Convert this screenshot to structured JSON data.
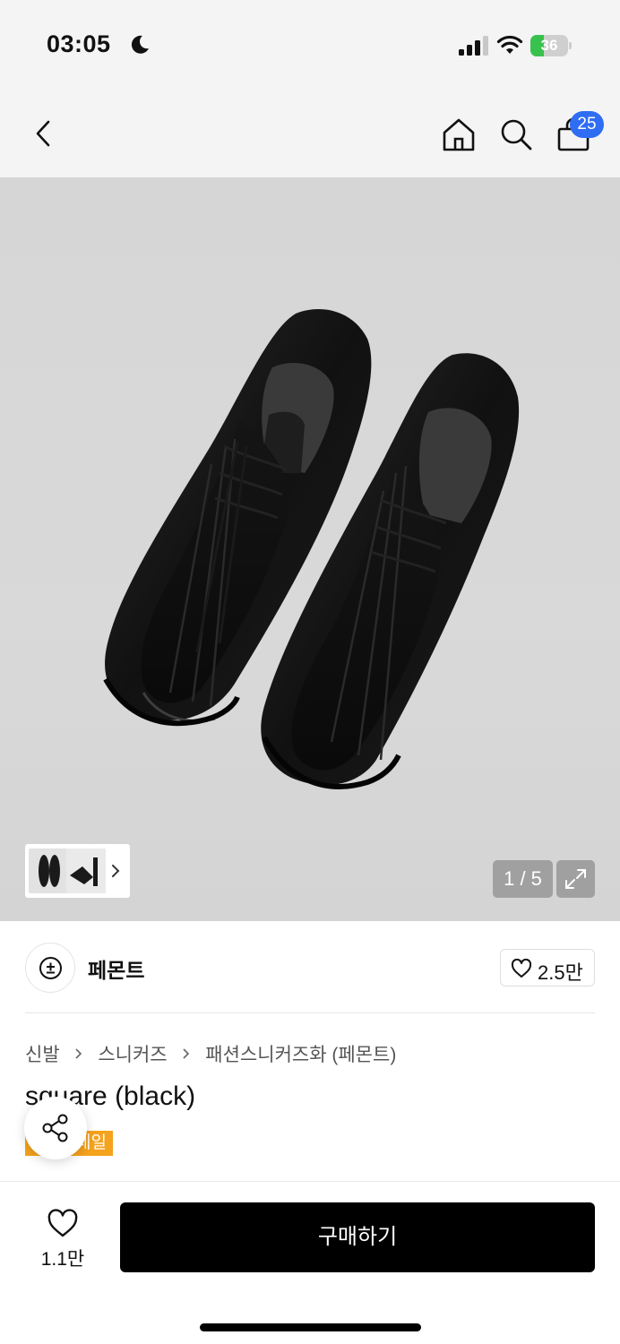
{
  "status_bar": {
    "time": "03:05",
    "battery_percent": "36",
    "battery_level": 0.36
  },
  "nav": {
    "cart_count": "25"
  },
  "gallery": {
    "page_indicator": "1 / 5"
  },
  "brand": {
    "name": "페몬트",
    "like_count": "2.5만"
  },
  "breadcrumb": [
    "신발",
    "스니커즈",
    "패션스니커즈화 (페몬트)"
  ],
  "product": {
    "title": "square (black)",
    "badge": "세일"
  },
  "purchase": {
    "wish_count": "1.1만",
    "buy_label": "구매하기"
  },
  "colors": {
    "accent_blue": "#2f6df3",
    "sale_orange": "#f5a21c",
    "buy_button": "#000000",
    "battery_green": "#39c14d"
  },
  "icons": [
    "moon-icon",
    "signal-icon",
    "wifi-icon",
    "battery-icon",
    "back-arrow-icon",
    "home-icon",
    "search-icon",
    "cart-icon",
    "chevron-right-icon",
    "expand-icon",
    "brand-logo-icon",
    "heart-icon",
    "share-icon"
  ]
}
